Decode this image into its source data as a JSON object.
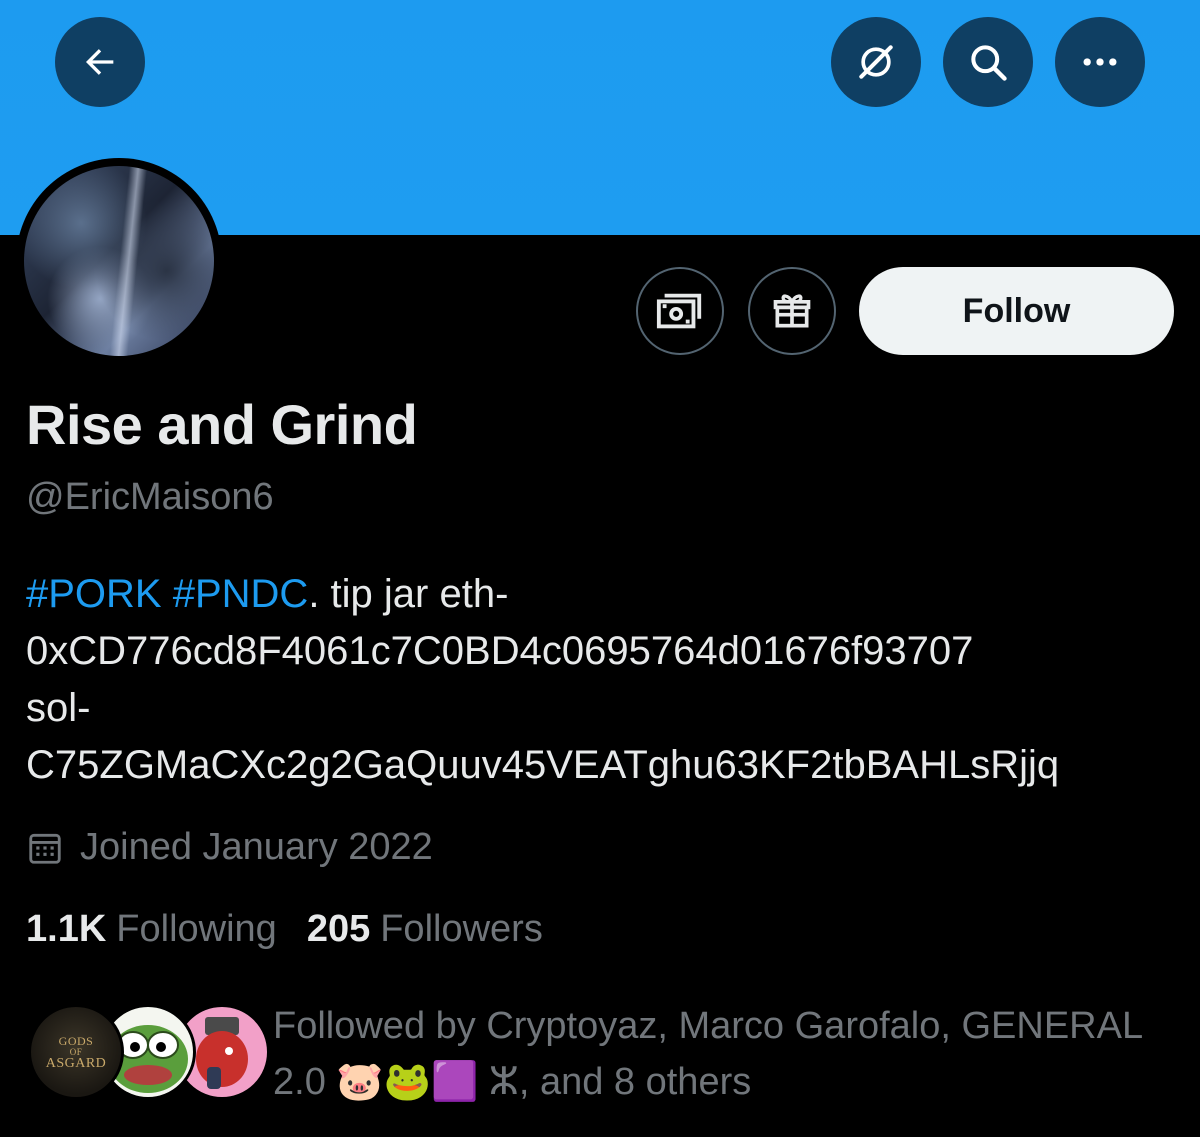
{
  "header": {
    "back_icon": "arrow-left-icon",
    "grok_icon": "grok-icon",
    "search_icon": "search-icon",
    "more_icon": "more-horizontal-icon",
    "banner_color": "#1d9bf0"
  },
  "actions": {
    "tip_icon": "money-icon",
    "gift_icon": "gift-icon",
    "follow_label": "Follow"
  },
  "profile": {
    "display_name": "Rise and Grind",
    "handle": "@EricMaison6",
    "bio": {
      "hashtag1": "#PORK",
      "hashtag2": "#PNDC",
      "line1_rest": ". tip jar eth-",
      "line2": "0xCD776cd8F4061c7C0BD4c0695764d01676f93707",
      "line3": "sol-",
      "line4": "C75ZGMaCXc2g2GaQuuv45VEATghu63KF2tbBAHLsRjjq"
    },
    "joined_icon": "calendar-icon",
    "joined": "Joined January 2022",
    "following_count": "1.1K",
    "following_label": "Following",
    "followers_count": "205",
    "followers_label": "Followers"
  },
  "followed_by": {
    "avatar1_text_line1": "GODS",
    "avatar1_text_line2": "OF",
    "avatar1_text_line3": "ASGARD",
    "text_part1": "Followed by Cryptoyaz, Marco Garofalo, GENERAL",
    "text_part2_prefix": "2.0 ",
    "emojis": "🐷🐸🟪",
    "text_part2_suffix": " ⵣ, and 8 others"
  },
  "colors": {
    "accent": "#1d9bf0",
    "text_primary": "#e7e9ea",
    "text_secondary": "#71767b",
    "button_bg": "#eff3f4"
  }
}
